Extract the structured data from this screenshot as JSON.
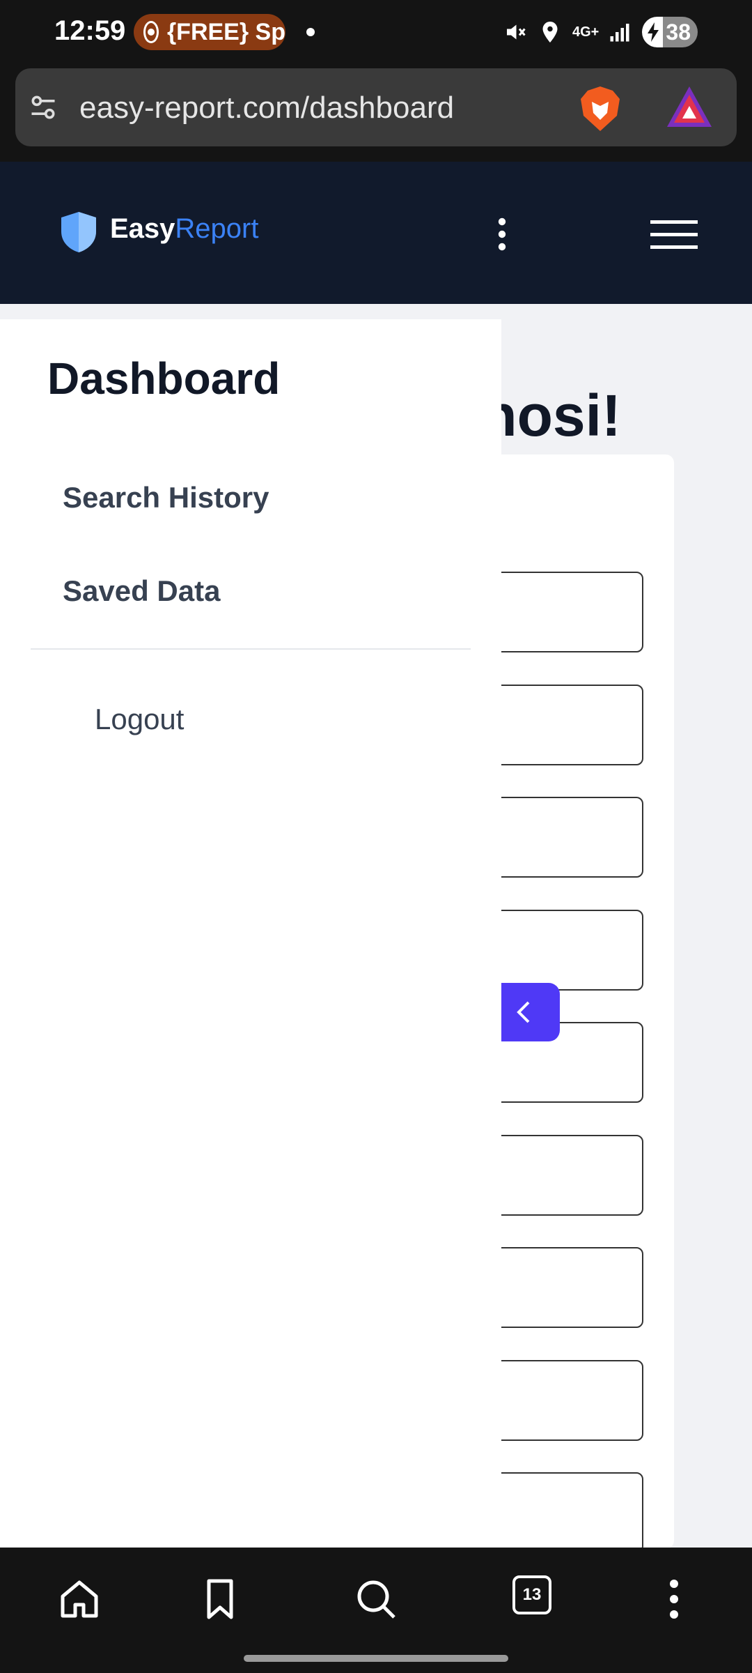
{
  "status_bar": {
    "time": "12:59",
    "notification_text": "{FREE} Sp",
    "network": "4G+",
    "battery": "38"
  },
  "browser": {
    "url": "easy-report.com/dashboard",
    "tab_count": "13"
  },
  "header": {
    "logo_primary": "Easy",
    "logo_accent": "Report",
    "accent_color": "#3b82f6",
    "background_color": "#111a2c"
  },
  "background": {
    "heading_fragment": "onosi!"
  },
  "drawer": {
    "title": "Dashboard",
    "items": [
      {
        "label": "Search History"
      },
      {
        "label": "Saved Data"
      }
    ],
    "logout_label": "Logout"
  },
  "icons": {
    "collapse": "chevron-left-icon",
    "menu": "hamburger-icon",
    "more": "kebab-icon"
  },
  "colors": {
    "collapse_button": "#4f39f6"
  }
}
